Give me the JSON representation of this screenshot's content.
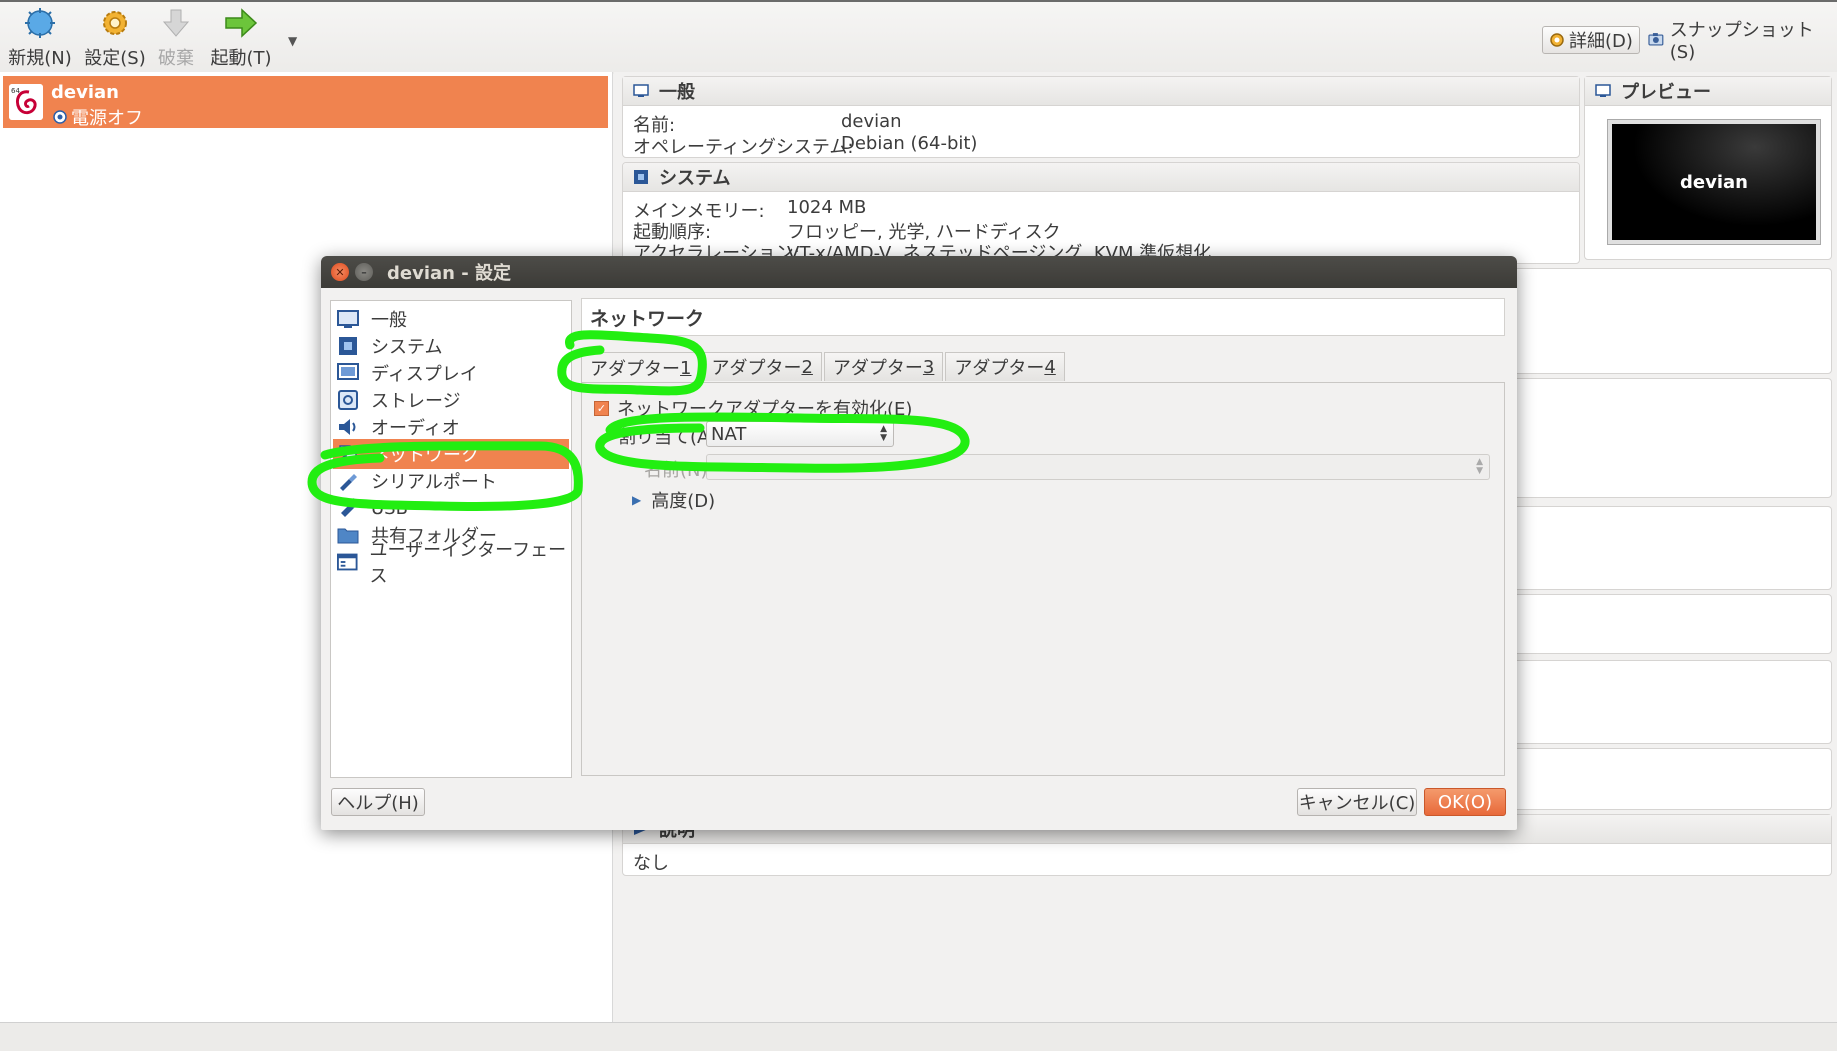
{
  "toolbar": {
    "new_label": "新規(N)",
    "settings_label": "設定(S)",
    "discard_label": "破棄",
    "start_label": "起動(T)",
    "details_label": "詳細(D)",
    "snapshots_label": "スナップショット(S)"
  },
  "vm_list": {
    "items": [
      {
        "name": "devian",
        "state": "電源オフ"
      }
    ]
  },
  "details": {
    "general": {
      "header": "一般",
      "name_label": "名前:",
      "name_value": "devian",
      "os_label": "オペレーティングシステム:",
      "os_value": "Debian (64-bit)"
    },
    "system": {
      "header": "システム",
      "memory_label": "メインメモリー:",
      "memory_value": "1024 MB",
      "boot_label": "起動順序:",
      "boot_value": "フロッピー, 光学, ハードディスク",
      "accel_label": "アクセラレーション:",
      "accel_value": "VT-x/AMD-V, ネステッドページング, KVM 準仮想化"
    },
    "preview": {
      "header": "プレビュー",
      "screen_text": "devian"
    },
    "description": {
      "header": "説明",
      "value": "なし"
    }
  },
  "dialog": {
    "title": "devian - 設定",
    "categories": [
      {
        "label": "一般",
        "icon": "general-icon"
      },
      {
        "label": "システム",
        "icon": "system-icon"
      },
      {
        "label": "ディスプレイ",
        "icon": "display-icon"
      },
      {
        "label": "ストレージ",
        "icon": "storage-icon"
      },
      {
        "label": "オーディオ",
        "icon": "audio-icon"
      },
      {
        "label": "ネットワーク",
        "icon": "network-icon",
        "selected": true
      },
      {
        "label": "シリアルポート",
        "icon": "serial-icon"
      },
      {
        "label": "USB",
        "icon": "usb-icon"
      },
      {
        "label": "共有フォルダー",
        "icon": "shared-folder-icon"
      },
      {
        "label": "ユーザーインターフェース",
        "icon": "user-interface-icon"
      }
    ],
    "page_title": "ネットワーク",
    "tabs": [
      {
        "label": "アダプター ",
        "key": "1",
        "active": true
      },
      {
        "label": "アダプター ",
        "key": "2"
      },
      {
        "label": "アダプター ",
        "key": "3"
      },
      {
        "label": "アダプター ",
        "key": "4"
      }
    ],
    "enable_adapter_label": "ネットワークアダプターを有効化(E)",
    "enable_adapter_checked": true,
    "attached_to_label": "割り当て(A):",
    "attached_to_value": "NAT",
    "name_label": "名前(N):",
    "name_value": "",
    "advanced_label": "高度(D)",
    "help_button": "ヘルプ(H)",
    "cancel_button": "キャンセル(C)",
    "ok_button": "OK(O)"
  },
  "colors": {
    "selection_orange": "#f0834f",
    "annotation_green": "#22ee11",
    "title_bar_dark": "#3c3b37"
  }
}
